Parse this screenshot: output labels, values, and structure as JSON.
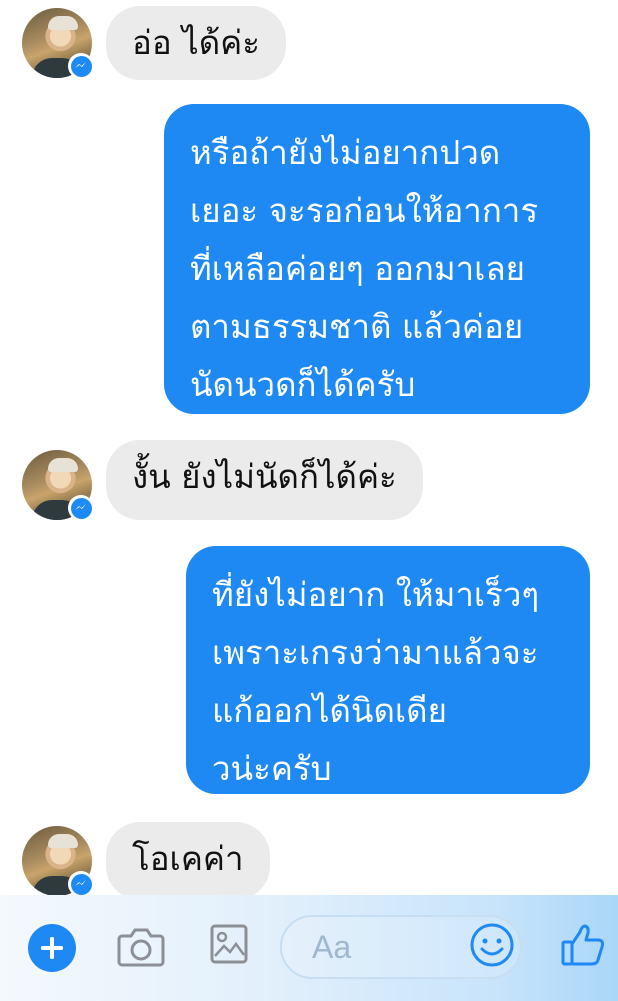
{
  "messages": [
    {
      "sender": "contact",
      "text": "อ่อ ได้ค่ะ"
    },
    {
      "sender": "me",
      "text": "หรือถ้ายังไม่อยากปวด\nเยอะ จะรอก่อนให้อาการ\nที่เหลือค่อยๆ ออกมาเลย\nตามธรรมชาติ แล้วค่อย\nนัดนวดก็ได้ครับ"
    },
    {
      "sender": "contact",
      "text": "งั้น ยังไม่นัดก็ได้ค่ะ"
    },
    {
      "sender": "me",
      "text": "ที่ยังไม่อยาก ให้มาเร็วๆ\nเพราะเกรงว่ามาแล้วจะ\nแก้ออกได้นิดเดีย\nวน่ะครับ"
    },
    {
      "sender": "contact",
      "text": "โอเคค่า"
    }
  ],
  "composer": {
    "placeholder": "Aa",
    "icons": [
      "plus-icon",
      "camera-icon",
      "image-icon",
      "emoji-icon",
      "thumbs-up-icon"
    ]
  },
  "colors": {
    "outgoing_bubble": "#1e88f3",
    "incoming_bubble": "#ebebec",
    "accent": "#1e88f3"
  }
}
